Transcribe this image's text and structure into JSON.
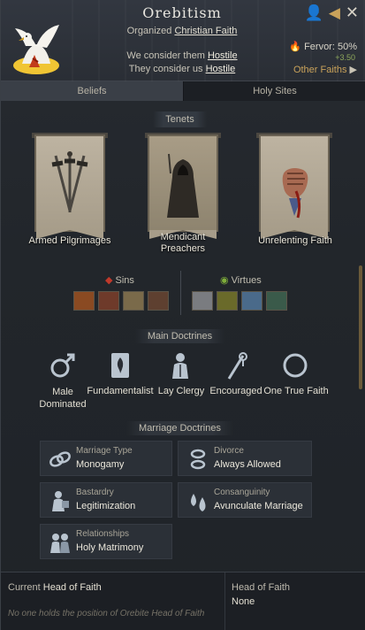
{
  "header": {
    "title": "Orebitism",
    "subtitle_prefix": "Organized",
    "subtitle_link": "Christian Faith",
    "we_consider_prefix": "We consider them",
    "we_consider_value": "Hostile",
    "they_consider_prefix": "They consider us",
    "they_consider_value": "Hostile",
    "fervor_label": "Fervor:",
    "fervor_value": "50%",
    "fervor_delta": "+3.50",
    "other_faiths": "Other Faiths",
    "icons": [
      "person-icon",
      "back-arrow-icon",
      "close-icon"
    ]
  },
  "tabs": [
    {
      "label": "Beliefs",
      "active": true
    },
    {
      "label": "Holy Sites",
      "active": false
    }
  ],
  "tenets": {
    "label": "Tenets",
    "items": [
      {
        "label": "Armed Pilgrimages",
        "icon": "crossed-daggers-icon"
      },
      {
        "label": "Mendicant\nPreachers",
        "icon": "hooded-monk-icon"
      },
      {
        "label": "Unrelenting Faith",
        "icon": "clenched-fist-icon"
      }
    ]
  },
  "sins": {
    "label": "Sins",
    "icons": [
      "sin-icon-1",
      "sin-icon-2",
      "sin-icon-3",
      "sin-icon-4"
    ]
  },
  "virtues": {
    "label": "Virtues",
    "icons": [
      "virtue-icon-1",
      "virtue-icon-2",
      "virtue-icon-3",
      "virtue-icon-4"
    ]
  },
  "main_doctrines": {
    "label": "Main Doctrines",
    "items": [
      {
        "label": "Male\nDominated",
        "icon": "male-symbol-icon"
      },
      {
        "label": "Fundamentalist",
        "icon": "holy-book-icon"
      },
      {
        "label": "Lay Clergy",
        "icon": "clergy-icon"
      },
      {
        "label": "Encouraged",
        "icon": "pilgrim-staff-icon"
      },
      {
        "label": "One True Faith",
        "icon": "ring-icon"
      }
    ]
  },
  "marriage_doctrines": {
    "label": "Marriage Doctrines",
    "items": [
      {
        "key": "Marriage Type",
        "value": "Monogamy",
        "icon": "rings-icon"
      },
      {
        "key": "Divorce",
        "value": "Always Allowed",
        "icon": "broken-rings-icon"
      },
      {
        "key": "Bastardry",
        "value": "Legitimization",
        "icon": "bastard-icon"
      },
      {
        "key": "Consanguinity",
        "value": "Avunculate Marriage",
        "icon": "blood-drops-icon"
      },
      {
        "key": "Relationships",
        "value": "Holy Matrimony",
        "icon": "couple-icon"
      }
    ]
  },
  "footer": {
    "current_head_prefix": "Current",
    "current_head_label": "Head of Faith",
    "current_head_note": "No one holds the position of Orebite Head of Faith",
    "head_label": "Head of Faith",
    "head_value": "None"
  },
  "colors": {
    "accent_gold": "#c9a25a",
    "fervor_green": "#8ea85c"
  }
}
